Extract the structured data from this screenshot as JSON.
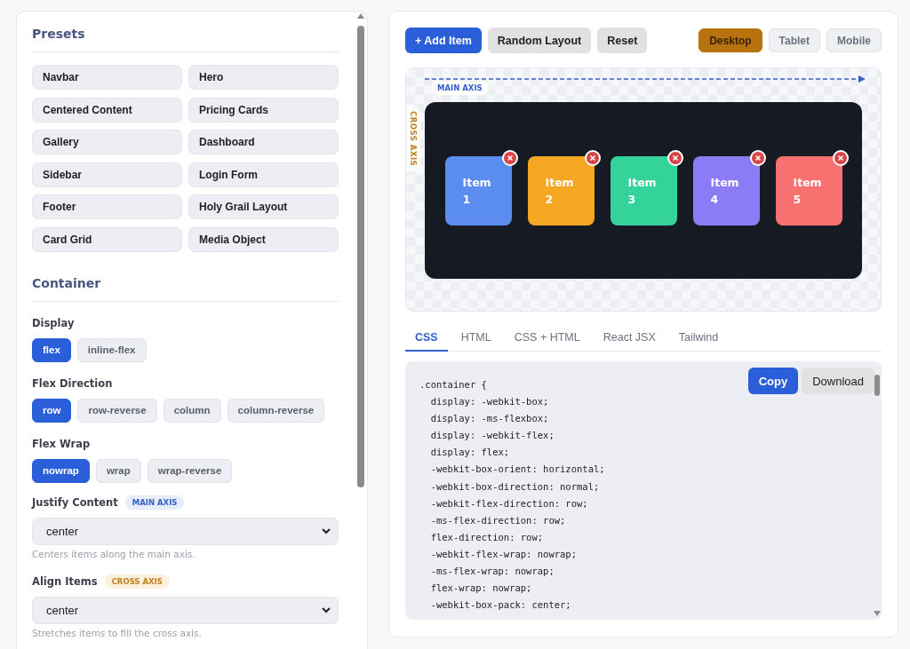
{
  "presets": {
    "title": "Presets",
    "items": [
      "Navbar",
      "Hero",
      "Centered Content",
      "Pricing Cards",
      "Gallery",
      "Dashboard",
      "Sidebar",
      "Login Form",
      "Footer",
      "Holy Grail Layout",
      "Card Grid",
      "Media Object"
    ]
  },
  "container": {
    "title": "Container",
    "groups": [
      {
        "label": "Display",
        "options": [
          {
            "label": "flex",
            "selected": true
          },
          {
            "label": "inline-flex",
            "selected": false
          }
        ]
      },
      {
        "label": "Flex Direction",
        "options": [
          {
            "label": "row",
            "selected": true
          },
          {
            "label": "row-reverse",
            "selected": false
          },
          {
            "label": "column",
            "selected": false
          },
          {
            "label": "column-reverse",
            "selected": false
          }
        ]
      },
      {
        "label": "Flex Wrap",
        "options": [
          {
            "label": "nowrap",
            "selected": true
          },
          {
            "label": "wrap",
            "selected": false
          },
          {
            "label": "wrap-reverse",
            "selected": false
          }
        ]
      }
    ],
    "selects": [
      {
        "label": "Justify Content",
        "badge": {
          "text": "MAIN AXIS",
          "kind": "main"
        },
        "value": "center",
        "hint": "Centers items along the main axis."
      },
      {
        "label": "Align Items",
        "badge": {
          "text": "CROSS AXIS",
          "kind": "cross"
        },
        "value": "center",
        "hint": "Stretches items to fill the cross axis."
      }
    ]
  },
  "toolbar": {
    "actions": [
      {
        "label": "+ Add Item",
        "kind": "primary"
      },
      {
        "label": "Random Layout",
        "kind": "secondary"
      },
      {
        "label": "Reset",
        "kind": "secondary"
      }
    ],
    "devices": [
      {
        "label": "Desktop",
        "selected": true
      },
      {
        "label": "Tablet",
        "selected": false
      },
      {
        "label": "Mobile",
        "selected": false
      }
    ]
  },
  "preview": {
    "main_axis_label": "MAIN AXIS",
    "cross_axis_label": "CROSS AXIS",
    "items": [
      {
        "label": "Item 1",
        "color": "#5b8def"
      },
      {
        "label": "Item 2",
        "color": "#f5a623"
      },
      {
        "label": "Item 3",
        "color": "#34d399"
      },
      {
        "label": "Item 4",
        "color": "#8b7cf6"
      },
      {
        "label": "Item 5",
        "color": "#f87171"
      }
    ]
  },
  "code": {
    "tabs": [
      {
        "label": "CSS",
        "selected": true
      },
      {
        "label": "HTML",
        "selected": false
      },
      {
        "label": "CSS + HTML",
        "selected": false
      },
      {
        "label": "React JSX",
        "selected": false
      },
      {
        "label": "Tailwind",
        "selected": false
      }
    ],
    "buttons": [
      {
        "label": "Copy",
        "kind": "primary"
      },
      {
        "label": "Download",
        "kind": "secondary"
      }
    ],
    "lines": [
      ".container {",
      "  display: -webkit-box;",
      "  display: -ms-flexbox;",
      "  display: -webkit-flex;",
      "  display: flex;",
      "  -webkit-box-orient: horizontal;",
      "  -webkit-box-direction: normal;",
      "  -webkit-flex-direction: row;",
      "  -ms-flex-direction: row;",
      "  flex-direction: row;",
      "  -webkit-flex-wrap: nowrap;",
      "  -ms-flex-wrap: nowrap;",
      "  flex-wrap: nowrap;",
      "  -webkit-box-pack: center;"
    ]
  }
}
